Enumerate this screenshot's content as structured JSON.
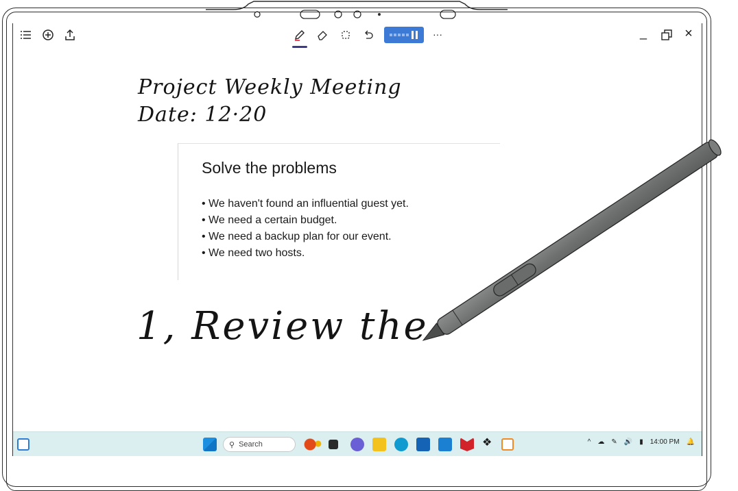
{
  "document": {
    "handwritten_title": "Project Weekly Meeting",
    "handwritten_date": "Date: 12·20",
    "handwritten_note": "1, Review the",
    "card": {
      "heading": "Solve the problems",
      "bullets": [
        "• We haven't found an influential guest yet.",
        "• We need a certain budget.",
        "• We need a backup plan for our event.",
        "• We need two hosts."
      ]
    }
  },
  "toolbar": {
    "left_icons": [
      "menu-icon",
      "add-circle-icon",
      "share-upload-icon"
    ],
    "tools": [
      "pen-icon",
      "eraser-icon",
      "lasso-select-icon",
      "undo-icon"
    ],
    "more_label": "···",
    "window_controls": {
      "minimize": "_",
      "restore": "restore-icon",
      "close": "×"
    }
  },
  "taskbar": {
    "search_label": "Search",
    "clock": "14:00 PM",
    "tray_up": "^",
    "colors": {
      "background": "#dbeff0",
      "record": "#3c7ad6"
    }
  }
}
